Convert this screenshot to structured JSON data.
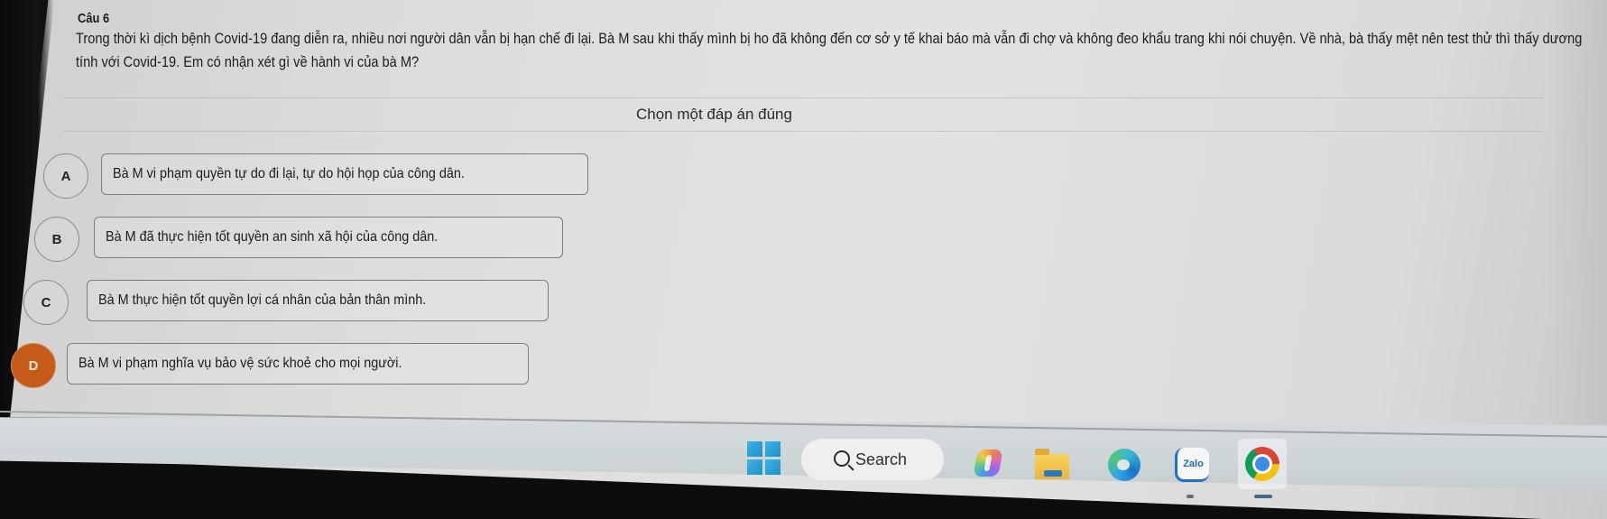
{
  "quiz": {
    "question_number": "Câu 6",
    "question_text": "Trong thời kì dịch bệnh Covid-19 đang diễn ra, nhiều nơi người dân vẫn bị hạn chế đi lại. Bà M sau khi thấy mình bị ho đã không đến cơ sở y tế khai báo mà vẫn đi chợ và không đeo khẩu trang khi nói chuyện. Về nhà, bà thấy mệt nên test thử thì thấy dương tính với Covid-19. Em có nhận xét gì về hành vi của bà M?",
    "instruction": "Chọn một đáp án đúng",
    "selected_option": "D",
    "options": [
      {
        "letter": "A",
        "text": "Bà M vi phạm quyền tự do đi lại, tự do hội họp của công dân.",
        "selected": false
      },
      {
        "letter": "B",
        "text": "Bà M đã thực hiện tốt quyền an sinh xã hội của công dân.",
        "selected": false
      },
      {
        "letter": "C",
        "text": "Bà M thực hiện tốt quyền lợi cá nhân của bản thân mình.",
        "selected": false
      },
      {
        "letter": "D",
        "text": "Bà M vi phạm nghĩa vụ bảo vệ sức khoẻ cho mọi người.",
        "selected": true
      }
    ],
    "selected_color": "#c55a19"
  },
  "taskbar": {
    "search_label": "Search",
    "apps": [
      {
        "name": "Start",
        "icon": "windows-start-icon"
      },
      {
        "name": "Copilot",
        "icon": "copilot-icon"
      },
      {
        "name": "File Explorer",
        "icon": "folder-icon"
      },
      {
        "name": "Microsoft Edge",
        "icon": "edge-icon"
      },
      {
        "name": "Zalo",
        "icon": "zalo-icon",
        "label": "Zalo",
        "running": true
      },
      {
        "name": "Google Chrome",
        "icon": "chrome-icon",
        "active": true
      }
    ]
  }
}
